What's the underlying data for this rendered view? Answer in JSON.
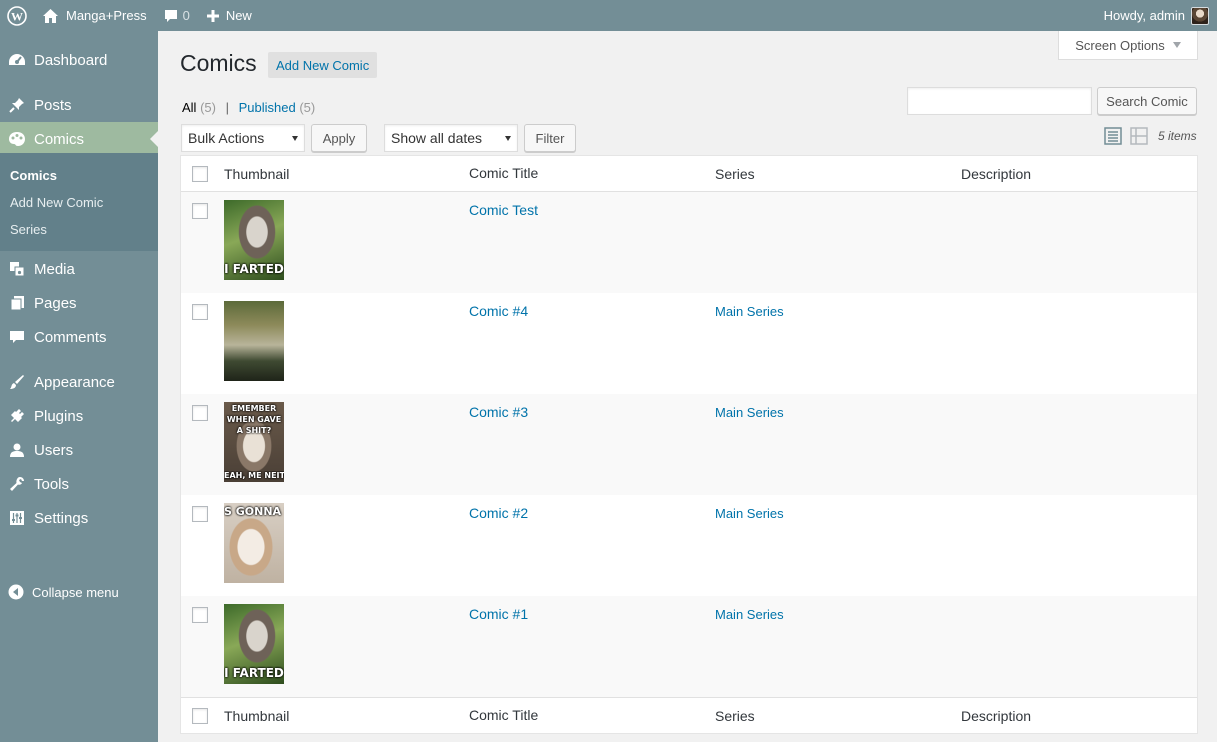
{
  "admin_bar": {
    "site_name": "Manga+Press",
    "comments_count": "0",
    "new_label": "New",
    "howdy": "Howdy, admin"
  },
  "sidebar": {
    "items": [
      {
        "label": "Dashboard",
        "icon": "dashboard-icon"
      },
      {
        "label": "Posts",
        "icon": "pin-icon"
      },
      {
        "label": "Comics",
        "icon": "palette-icon"
      },
      {
        "label": "Media",
        "icon": "media-icon"
      },
      {
        "label": "Pages",
        "icon": "pages-icon"
      },
      {
        "label": "Comments",
        "icon": "comment-icon"
      },
      {
        "label": "Appearance",
        "icon": "brush-icon"
      },
      {
        "label": "Plugins",
        "icon": "plug-icon"
      },
      {
        "label": "Users",
        "icon": "user-icon"
      },
      {
        "label": "Tools",
        "icon": "wrench-icon"
      },
      {
        "label": "Settings",
        "icon": "sliders-icon"
      }
    ],
    "submenu": [
      "Comics",
      "Add New Comic",
      "Series"
    ],
    "collapse_label": "Collapse menu"
  },
  "screen_options_label": "Screen Options",
  "page": {
    "title": "Comics",
    "add_new_label": "Add New Comic"
  },
  "filters": {
    "all_label": "All",
    "all_count": "(5)",
    "separator": "|",
    "published_label": "Published",
    "published_count": "(5)"
  },
  "search": {
    "value": "",
    "button_label": "Search Comic"
  },
  "bulk": {
    "selected": "Bulk Actions",
    "apply_label": "Apply",
    "dates_selected": "Show all dates",
    "filter_label": "Filter"
  },
  "items_count": "5 items",
  "table": {
    "columns": [
      "Thumbnail",
      "Comic Title",
      "Series",
      "Description"
    ],
    "rows": [
      {
        "title": "Comic Test",
        "series": "",
        "description": "",
        "thumb_caption_bottom": "I FARTED",
        "thumb_caption_top": ""
      },
      {
        "title": "Comic #4",
        "series": "Main Series",
        "description": "",
        "thumb_caption_bottom": "",
        "thumb_caption_top": ""
      },
      {
        "title": "Comic #3",
        "series": "Main Series",
        "description": "",
        "thumb_caption_top": "EMEMBER WHEN GAVE A SHIT?",
        "thumb_caption_bottom": "EAH, ME NEITHE"
      },
      {
        "title": "Comic #2",
        "series": "Main Series",
        "description": "",
        "thumb_caption_top": "S GONNA HA",
        "thumb_caption_bottom": ""
      },
      {
        "title": "Comic #1",
        "series": "Main Series",
        "description": "",
        "thumb_caption_bottom": "I FARTED",
        "thumb_caption_top": ""
      }
    ]
  },
  "colors": {
    "sidebar": "#738e96",
    "sidebar_current": "#9ebaa0",
    "submenu": "#62808a",
    "link": "#0073aa"
  }
}
